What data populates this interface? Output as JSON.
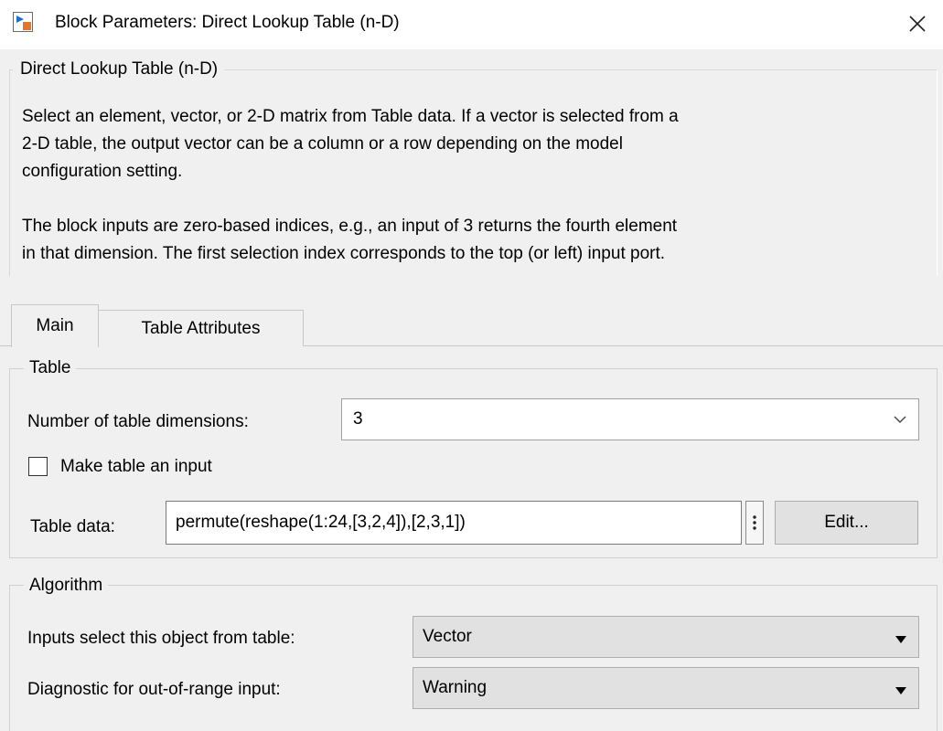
{
  "window": {
    "title": "Block Parameters: Direct Lookup Table (n-D)"
  },
  "icons": {
    "app": "simulink-block-icon",
    "close": "close-icon"
  },
  "description": {
    "legend": "Direct Lookup Table (n-D)",
    "paragraph1": "Select an element, vector, or 2-D matrix from Table data. If a vector is selected from a\n2-D table, the output vector can be a column or a row depending on the model\nconfiguration setting.",
    "paragraph2": "The block inputs are zero-based indices, e.g., an input of 3 returns the fourth element\nin that dimension. The first selection index corresponds to the top (or left) input port."
  },
  "tabs": [
    {
      "label": "Main",
      "active": true
    },
    {
      "label": "Table Attributes",
      "active": false
    }
  ],
  "table_group": {
    "legend": "Table",
    "dims_label": "Number of table dimensions:",
    "dims_value": "3",
    "make_input_label": "Make table an input",
    "make_input_checked": false,
    "table_data_label": "Table data:",
    "table_data_value": "permute(reshape(1:24,[3,2,4]),[2,3,1])",
    "edit_label": "Edit..."
  },
  "algorithm_group": {
    "legend": "Algorithm",
    "inputs_select_label": "Inputs select this object from table:",
    "inputs_select_value": "Vector",
    "diagnostic_label": "Diagnostic for out-of-range input:",
    "diagnostic_value": "Warning"
  },
  "colors": {
    "panel_bg": "#f0f0f0",
    "dialog_bg": "#ffffff",
    "dropdown_bg": "#e1e1e1",
    "border": "#adadad"
  }
}
